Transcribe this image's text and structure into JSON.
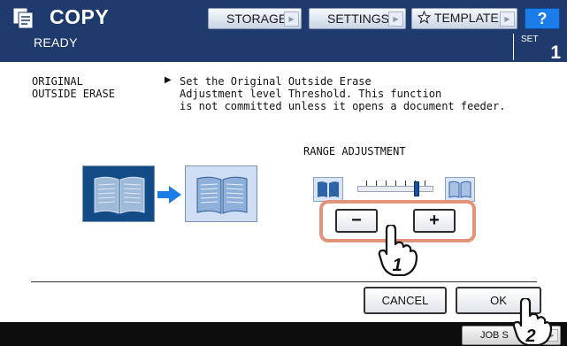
{
  "app": {
    "title": "COPY",
    "icon": "copier-icon"
  },
  "header": {
    "tabs": [
      {
        "label": "STORAGE",
        "icon": "chevron-right-icon"
      },
      {
        "label": "SETTINGS",
        "icon": "chevron-right-icon"
      },
      {
        "label": "TEMPLATE",
        "icon": "star-icon"
      }
    ],
    "help_label": "?",
    "status": "READY",
    "set_label": "SET",
    "set_count": "1"
  },
  "content": {
    "function_name": "ORIGINAL\nOUTSIDE ERASE",
    "description_marker": "▶",
    "description": "Set the Original Outside Erase\nAdjustment level Threshold. This function\nis not committed unless it opens a document feeder.",
    "range_title": "RANGE ADJUSTMENT",
    "range_level": 0.86,
    "minus_label": "−",
    "plus_label": "+",
    "step_badges": [
      "1",
      "2"
    ]
  },
  "actions": {
    "cancel_label": "CANCEL",
    "ok_label": "OK",
    "job_status_label": "JOB S"
  },
  "colors": {
    "header_bg": "#1f3b6e",
    "help_blue": "#1a7de8",
    "highlight_frame": "#e3937a",
    "book_dark": "#124b86",
    "book_light": "#cfdef2"
  }
}
